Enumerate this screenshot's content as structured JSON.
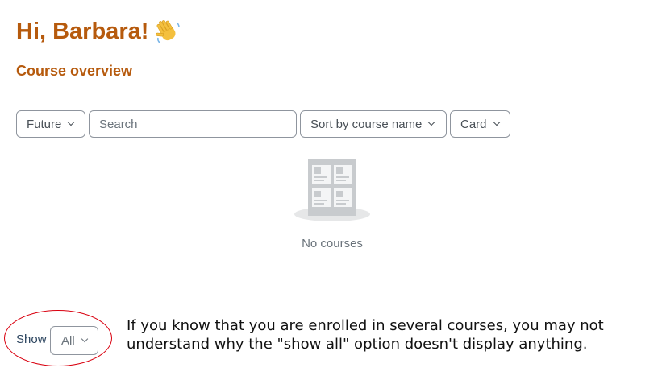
{
  "page": {
    "greeting": "Hi, Barbara!",
    "greeting_emoji": "waving-hand-icon",
    "section_title": "Course overview"
  },
  "filters": {
    "grouping_label": "Future",
    "search_placeholder": "Search",
    "sort_label": "Sort by course name",
    "view_label": "Card"
  },
  "empty_state": {
    "icon": "courses-empty-icon",
    "text": "No courses"
  },
  "paging": {
    "show_label": "Show",
    "show_value": "All"
  },
  "annotation": {
    "color": "#d9000f",
    "note": "If you know that you are enrolled in several courses, you may not understand why the \"show all\" option doesn't display anything."
  },
  "colors": {
    "accent": "#b65a0d",
    "border": "#8f959e",
    "muted_text": "#6a737b"
  }
}
